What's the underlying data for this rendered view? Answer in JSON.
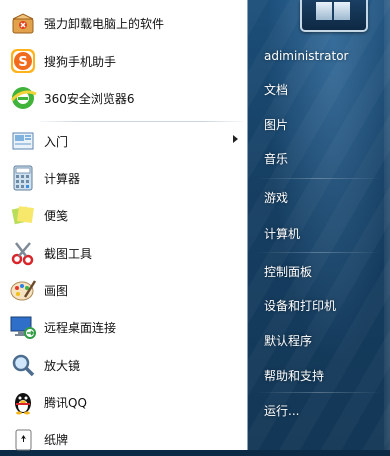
{
  "programs": [
    {
      "label": "强力卸载电脑上的软件",
      "icon": "uninstall-box-icon"
    },
    {
      "label": "搜狗手机助手",
      "icon": "sogou-assistant-icon"
    },
    {
      "label": "360安全浏览器6",
      "icon": "360-browser-icon"
    },
    {
      "label": "入门",
      "icon": "getting-started-icon",
      "has_submenu": true
    },
    {
      "label": "计算器",
      "icon": "calculator-icon"
    },
    {
      "label": "便笺",
      "icon": "sticky-notes-icon"
    },
    {
      "label": "截图工具",
      "icon": "snipping-tool-icon"
    },
    {
      "label": "画图",
      "icon": "paint-icon"
    },
    {
      "label": "远程桌面连接",
      "icon": "remote-desktop-icon"
    },
    {
      "label": "放大镜",
      "icon": "magnifier-icon"
    },
    {
      "label": "腾讯QQ",
      "icon": "qq-penguin-icon"
    },
    {
      "label": "纸牌",
      "icon": "solitaire-icon"
    }
  ],
  "right_panel": {
    "user_name": "adiministrator",
    "items": [
      "文档",
      "图片",
      "音乐",
      "游戏",
      "计算机",
      "控制面板",
      "设备和打印机",
      "默认程序",
      "帮助和支持",
      "运行..."
    ]
  }
}
